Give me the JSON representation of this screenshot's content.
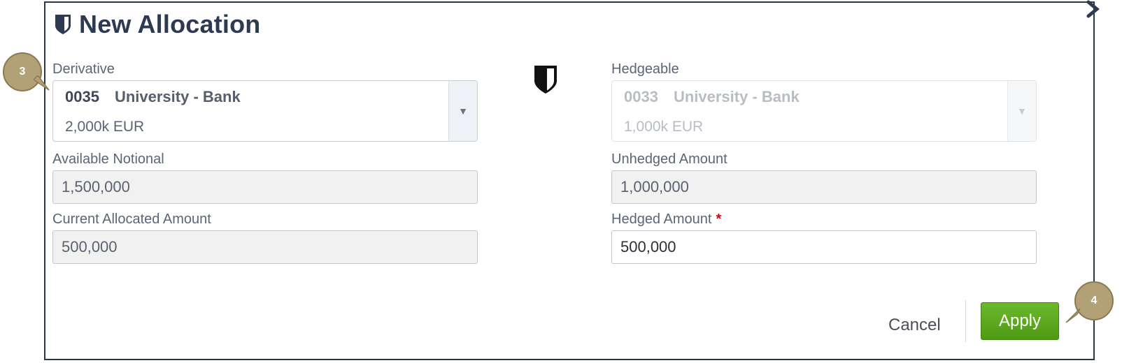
{
  "dialog": {
    "title": "New Allocation"
  },
  "derivative": {
    "label": "Derivative",
    "code": "0035",
    "name": "University - Bank",
    "amount": "2,000k EUR"
  },
  "hedgeable": {
    "label": "Hedgeable",
    "code": "0033",
    "name": "University - Bank",
    "amount": "1,000k EUR"
  },
  "available_notional": {
    "label": "Available Notional",
    "value": "1,500,000"
  },
  "current_allocated": {
    "label": "Current Allocated Amount",
    "value": "500,000"
  },
  "unhedged_amount": {
    "label": "Unhedged Amount",
    "value": "1,000,000"
  },
  "hedged_amount": {
    "label": "Hedged Amount",
    "required_marker": "*",
    "value": "500,000"
  },
  "actions": {
    "cancel_label": "Cancel",
    "apply_label": "Apply"
  },
  "callouts": {
    "first": "3",
    "second": "4"
  },
  "icons": {
    "title": "shield-icon",
    "center": "shield-icon",
    "close": "close-icon",
    "dropdown": "chevron-down-icon"
  },
  "colors": {
    "title_text": "#2e3a4f",
    "frame_border": "#2b3548",
    "apply_button": "#5aa81f",
    "required": "#d0021b",
    "callout": "#b2a176"
  }
}
